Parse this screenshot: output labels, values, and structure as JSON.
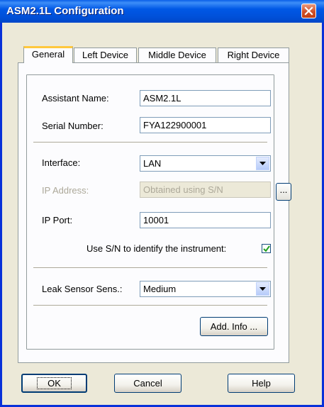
{
  "window": {
    "title": "ASM2.1L Configuration"
  },
  "tabs": [
    "General",
    "Left Device",
    "Middle Device",
    "Right Device"
  ],
  "general": {
    "assistant_name": {
      "label": "Assistant Name:",
      "value": "ASM2.1L"
    },
    "serial_number": {
      "label": "Serial Number:",
      "value": "FYA122900001"
    },
    "interface": {
      "label": "Interface:",
      "value": "LAN"
    },
    "ip_address": {
      "label": "IP Address:",
      "value": "Obtained using S/N",
      "browse_label": "..."
    },
    "ip_port": {
      "label": "IP Port:",
      "value": "10001"
    },
    "use_sn": {
      "label": "Use S/N to identify the instrument:",
      "checked": true
    },
    "leak_sensor": {
      "label": "Leak Sensor Sens.:",
      "value": "Medium"
    },
    "add_info_label": "Add. Info ..."
  },
  "buttons": {
    "ok": "OK",
    "cancel": "Cancel",
    "help": "Help"
  }
}
